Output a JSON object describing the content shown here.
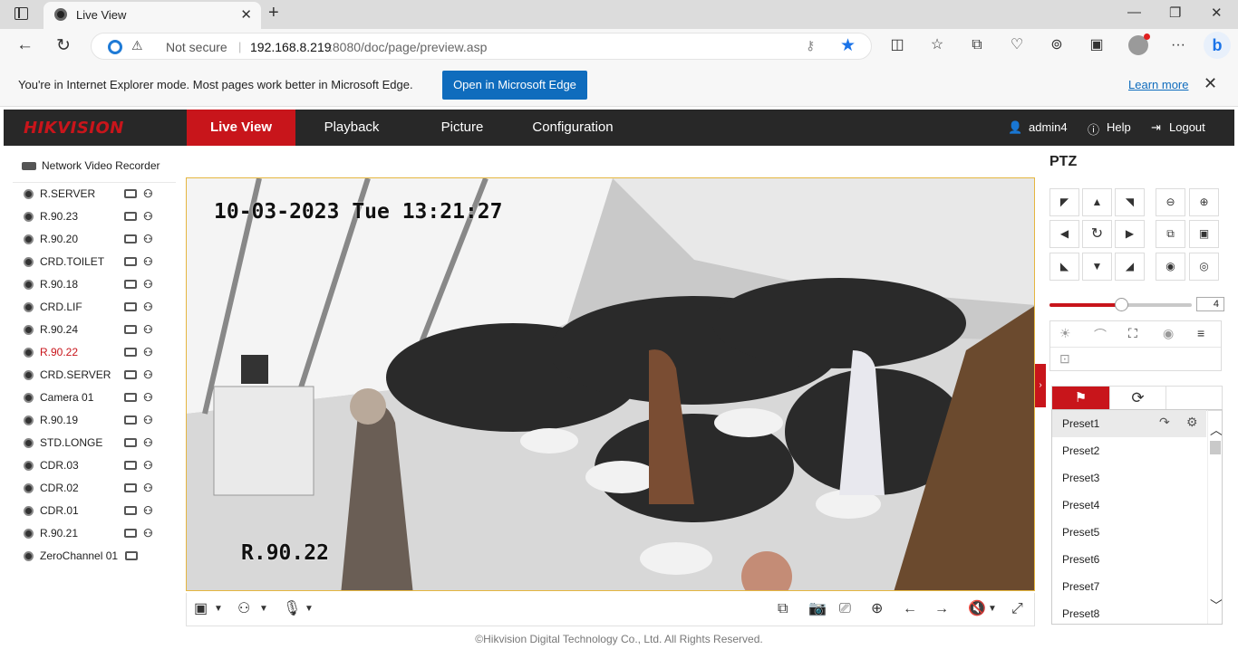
{
  "browser": {
    "tab_title": "Live View",
    "url_security": "Not secure",
    "url_host": "192.168.8.219",
    "url_path": ":8080/doc/page/preview.asp"
  },
  "ie_bar": {
    "message": "You're in Internet Explorer mode. Most pages work better in Microsoft Edge.",
    "open_button": "Open in Microsoft Edge",
    "learn_more": "Learn more"
  },
  "app": {
    "logo": "HIKVISION",
    "nav": [
      "Live View",
      "Playback",
      "Picture",
      "Configuration"
    ],
    "active_nav": "Live View",
    "user": "admin4",
    "help": "Help",
    "logout": "Logout",
    "accent_color": "#c8151b"
  },
  "sidebar": {
    "device": "Network Video Recorder",
    "cameras": [
      {
        "name": "R.SERVER"
      },
      {
        "name": "R.90.23"
      },
      {
        "name": "R.90.20"
      },
      {
        "name": "CRD.TOILET"
      },
      {
        "name": "R.90.18"
      },
      {
        "name": "CRD.LIF"
      },
      {
        "name": "R.90.24"
      },
      {
        "name": "R.90.22",
        "active": true
      },
      {
        "name": "CRD.SERVER"
      },
      {
        "name": "Camera 01"
      },
      {
        "name": "R.90.19"
      },
      {
        "name": "STD.LONGE"
      },
      {
        "name": "CDR.03"
      },
      {
        "name": "CDR.02"
      },
      {
        "name": "CDR.01"
      },
      {
        "name": "R.90.21"
      },
      {
        "name": "ZeroChannel 01"
      }
    ]
  },
  "video": {
    "osd_datetime": "10-03-2023 Tue 13:21:27",
    "osd_channel": "R.90.22"
  },
  "ptz": {
    "title": "PTZ",
    "speed": "4",
    "speed_fraction": 0.5,
    "presets": [
      "Preset1",
      "Preset2",
      "Preset3",
      "Preset4",
      "Preset5",
      "Preset6",
      "Preset7",
      "Preset8"
    ]
  },
  "footer": "©Hikvision Digital Technology Co., Ltd. All Rights Reserved."
}
